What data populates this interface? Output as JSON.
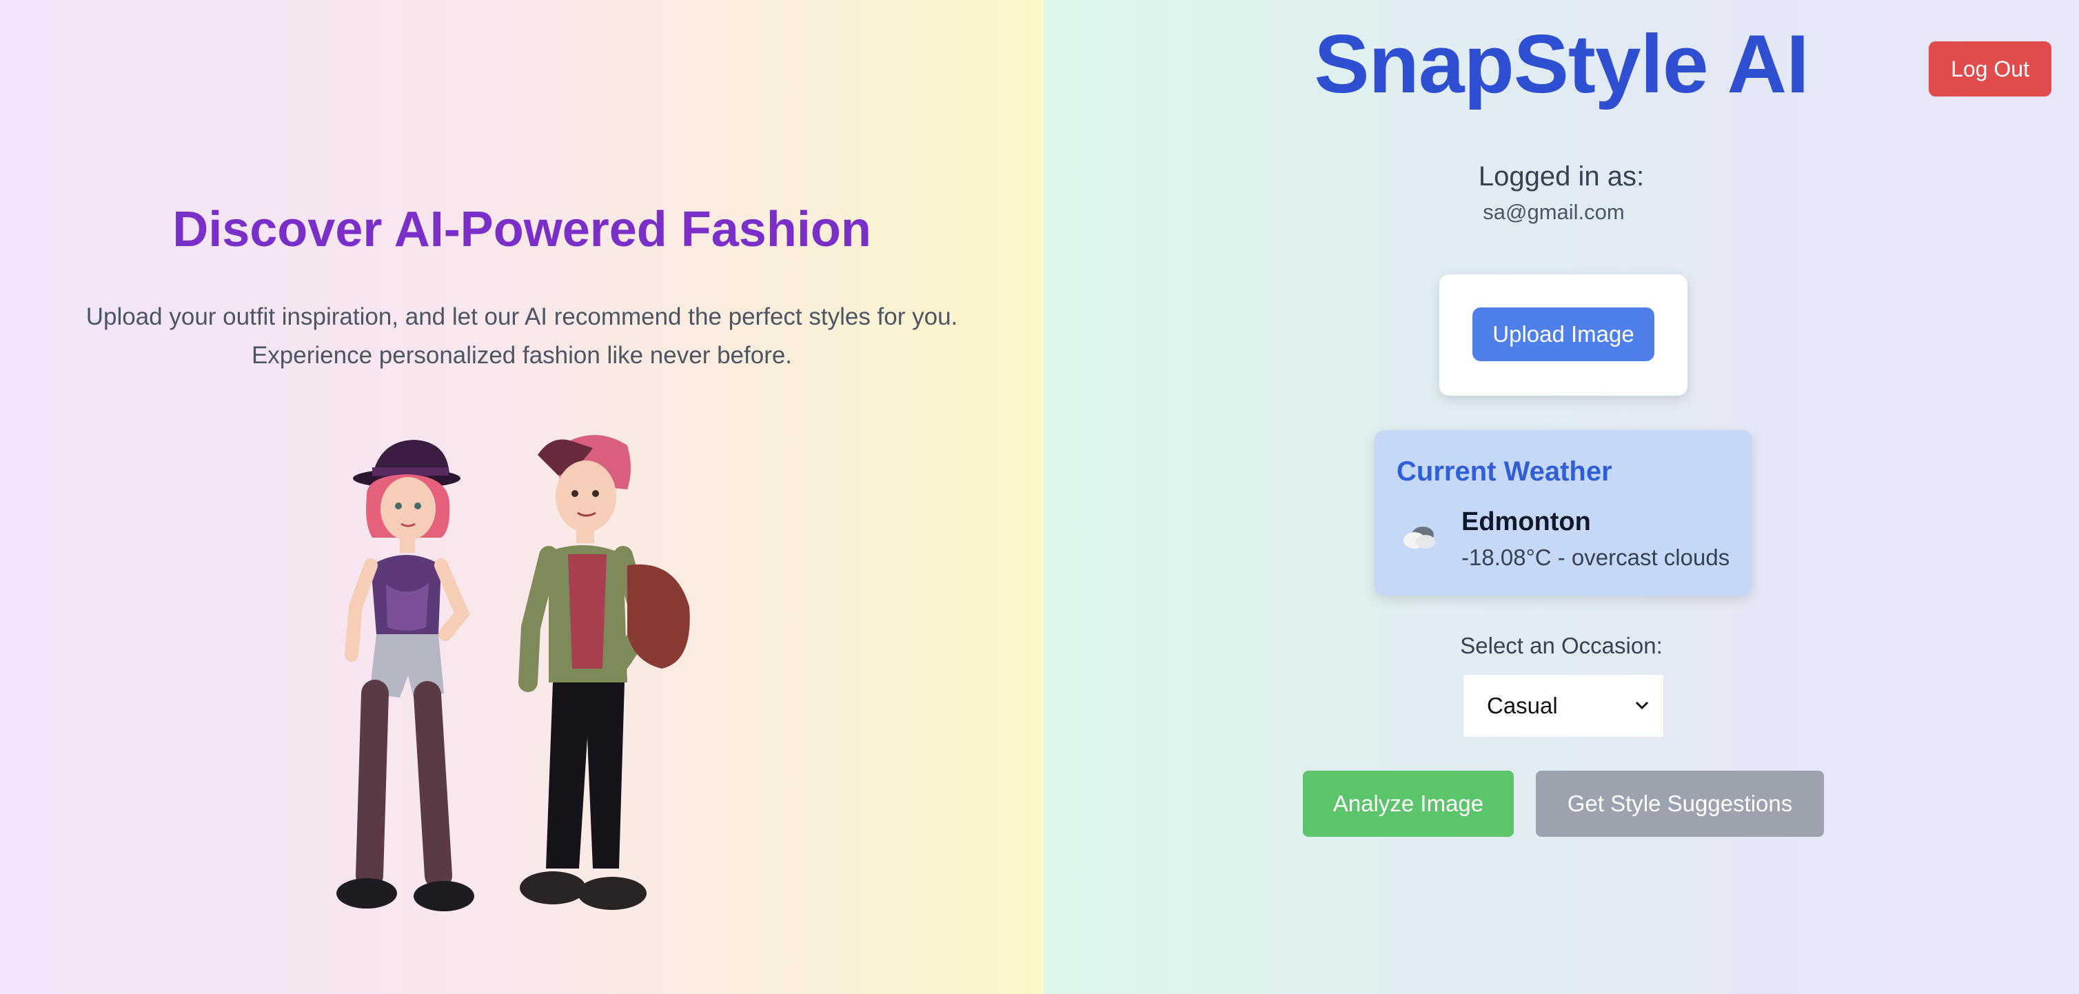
{
  "app": {
    "title": "SnapStyle AI",
    "logout_label": "Log Out"
  },
  "hero": {
    "title": "Discover AI-Powered Fashion",
    "line1": "Upload your outfit inspiration, and let our AI recommend the perfect styles for you.",
    "line2": "Experience personalized fashion like never before.",
    "illustration_icon": "two-fashion-characters-illustration"
  },
  "user": {
    "logged_in_label": "Logged in as:",
    "email": "sa@gmail.com"
  },
  "upload": {
    "button_label": "Upload Image"
  },
  "weather": {
    "title": "Current Weather",
    "city": "Edmonton",
    "description": "-18.08°C - overcast clouds",
    "icon": "cloud-icon"
  },
  "occasion": {
    "label": "Select an Occasion:",
    "selected": "Casual"
  },
  "actions": {
    "analyze_label": "Analyze Image",
    "suggest_label": "Get Style Suggestions"
  },
  "colors": {
    "title_blue": "#2f4fd3",
    "hero_purple": "#7b2fc9",
    "logout_red": "#e04b4b",
    "upload_blue": "#4f80e9",
    "analyze_green": "#5cc46a",
    "suggest_gray": "#9ca3af",
    "weather_bg": "#c5d8f8"
  }
}
